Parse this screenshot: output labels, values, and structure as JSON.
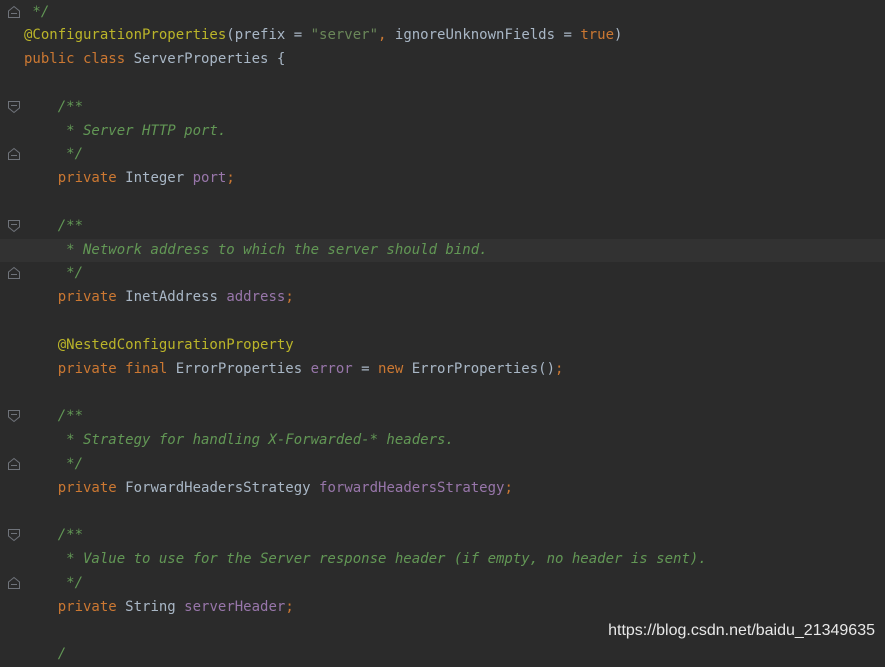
{
  "editor": {
    "lines": [
      [
        {
          "t": " */",
          "k": "comment"
        }
      ],
      [
        {
          "t": "@ConfigurationProperties",
          "k": "annot"
        },
        {
          "t": "(prefix = ",
          "k": "plain"
        },
        {
          "t": "\"server\"",
          "k": "string"
        },
        {
          "t": ", ",
          "k": "punct"
        },
        {
          "t": "ignoreUnknownFields = ",
          "k": "plain"
        },
        {
          "t": "true",
          "k": "keyword"
        },
        {
          "t": ")",
          "k": "plain"
        }
      ],
      [
        {
          "t": "public class ",
          "k": "keyword"
        },
        {
          "t": "ServerProperties {",
          "k": "plain"
        }
      ],
      [],
      [
        {
          "t": "    /**",
          "k": "comment"
        }
      ],
      [
        {
          "t": "     * Server HTTP port.",
          "k": "comment"
        }
      ],
      [
        {
          "t": "     */",
          "k": "comment"
        }
      ],
      [
        {
          "t": "    private ",
          "k": "keyword"
        },
        {
          "t": "Integer ",
          "k": "plain"
        },
        {
          "t": "port",
          "k": "field"
        },
        {
          "t": ";",
          "k": "punct"
        }
      ],
      [],
      [
        {
          "t": "    /**",
          "k": "comment"
        }
      ],
      [
        {
          "t": "     * Network address to which the server should bind.",
          "k": "comment"
        }
      ],
      [
        {
          "t": "     */",
          "k": "comment"
        }
      ],
      [
        {
          "t": "    private ",
          "k": "keyword"
        },
        {
          "t": "InetAddress ",
          "k": "plain"
        },
        {
          "t": "address",
          "k": "field"
        },
        {
          "t": ";",
          "k": "punct"
        }
      ],
      [],
      [
        {
          "t": "    @NestedConfigurationProperty",
          "k": "annot"
        }
      ],
      [
        {
          "t": "    private final ",
          "k": "keyword"
        },
        {
          "t": "ErrorProperties ",
          "k": "plain"
        },
        {
          "t": "error ",
          "k": "field"
        },
        {
          "t": "= ",
          "k": "plain"
        },
        {
          "t": "new ",
          "k": "keyword"
        },
        {
          "t": "ErrorProperties()",
          "k": "plain"
        },
        {
          "t": ";",
          "k": "punct"
        }
      ],
      [],
      [
        {
          "t": "    /**",
          "k": "comment"
        }
      ],
      [
        {
          "t": "     * Strategy for handling X-Forwarded-* headers.",
          "k": "comment"
        }
      ],
      [
        {
          "t": "     */",
          "k": "comment"
        }
      ],
      [
        {
          "t": "    private ",
          "k": "keyword"
        },
        {
          "t": "ForwardHeadersStrategy ",
          "k": "plain"
        },
        {
          "t": "forwardHeadersStrategy",
          "k": "field"
        },
        {
          "t": ";",
          "k": "punct"
        }
      ],
      [],
      [
        {
          "t": "    /**",
          "k": "comment"
        }
      ],
      [
        {
          "t": "     * Value to use for the Server response header (if empty, no header is sent).",
          "k": "comment"
        }
      ],
      [
        {
          "t": "     */",
          "k": "comment"
        }
      ],
      [
        {
          "t": "    private ",
          "k": "keyword"
        },
        {
          "t": "String ",
          "k": "plain"
        },
        {
          "t": "serverHeader",
          "k": "field"
        },
        {
          "t": ";",
          "k": "punct"
        }
      ],
      [],
      [
        {
          "t": "    /",
          "k": "comment"
        }
      ]
    ],
    "current_line": 10,
    "fold_end_lines": [
      0,
      6,
      11,
      19,
      24
    ],
    "fold_start_lines": [
      4,
      9,
      17,
      22
    ],
    "colors": {
      "background": "#2b2b2b",
      "comment": "#629755",
      "annotation": "#bbb529",
      "keyword": "#cc7832",
      "string": "#6a8759",
      "field": "#9876aa",
      "plain": "#a9b7c6"
    }
  },
  "watermark": "https://blog.csdn.net/baidu_21349635"
}
